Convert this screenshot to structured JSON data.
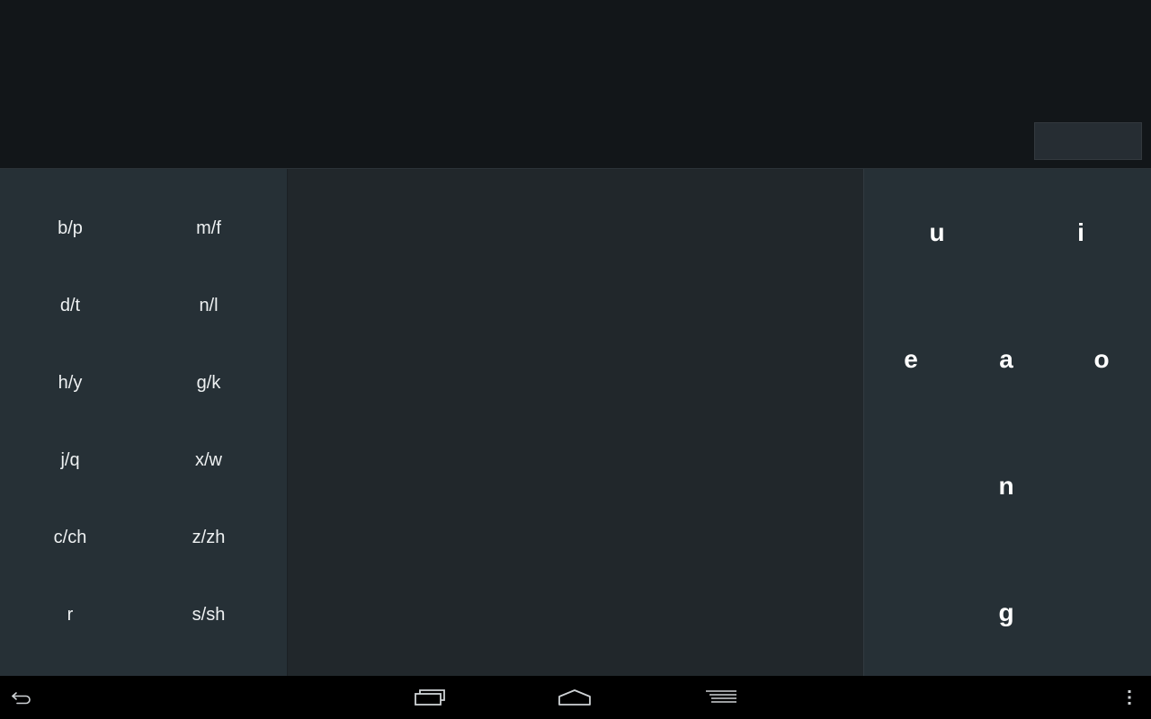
{
  "colors": {
    "top_background": "#121619",
    "side_panels": "#263036",
    "middle_panel": "#21272b",
    "key_text": "#eef1f2",
    "nav_bar": "#000000",
    "nav_icons": "#cfd3d6"
  },
  "consonant_keys": {
    "bp": "b/p",
    "mf": "m/f",
    "dt": "d/t",
    "nl": "n/l",
    "hy": "h/y",
    "gk": "g/k",
    "jq": "j/q",
    "xw": "x/w",
    "cch": "c/ch",
    "zzh": "z/zh",
    "r": "r",
    "ssh": "s/sh"
  },
  "vowel_keys": {
    "u": "u",
    "i": "i",
    "e": "e",
    "a": "a",
    "o": "o",
    "n": "n",
    "g": "g"
  },
  "nav_icons": {
    "back": "back-icon",
    "recent": "recent-apps-icon",
    "home": "home-icon",
    "ime": "keyboard-switch-icon",
    "menu": "overflow-menu-icon"
  }
}
